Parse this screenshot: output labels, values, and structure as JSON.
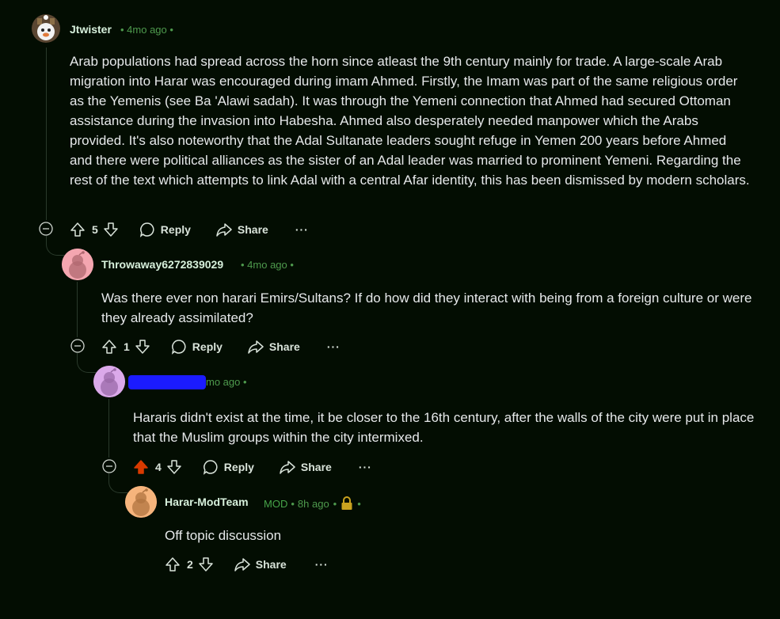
{
  "comments": [
    {
      "username": "Jtwister",
      "time": "4mo ago",
      "body": "Arab populations had spread across the horn since atleast the 9th century mainly for trade. A large-scale Arab migration into Harar was encouraged during imam Ahmed. Firstly, the Imam was part of the same religious order as the Yemenis (see Ba 'Alawi sadah). It was through the Yemeni connection that Ahmed had secured Ottoman assistance during the invasion into Habesha. Ahmed also desperately needed manpower which the Arabs provided. It's also noteworthy that the Adal Sultanate leaders sought refuge in Yemen 200 years before Ahmed and there were political alliances as the sister of an Adal leader was married to prominent Yemeni. Regarding the rest of the text which attempts to link Adal with a central Afar identity, this has been dismissed by modern scholars.",
      "votes": "5",
      "reply_label": "Reply",
      "share_label": "Share",
      "more_label": "···"
    },
    {
      "username": "Throwaway6272839029",
      "time": "4mo ago",
      "body": "Was there ever non harari Emirs/Sultans? If do how did they interact with being from a foreign culture or were they already assimilated?",
      "votes": "1",
      "reply_label": "Reply",
      "share_label": "Share",
      "more_label": "···"
    },
    {
      "username": "",
      "time": "3mo ago",
      "time_visible": "mo ago",
      "body": "Hararis didn't exist at the time, it be closer to the 16th century, after the walls of the city were put in place that the Muslim groups within the city intermixed.",
      "votes": "4",
      "upvoted": true,
      "reply_label": "Reply",
      "share_label": "Share",
      "more_label": "···"
    },
    {
      "username": "Harar-ModTeam",
      "flair": "MOD",
      "time": "8h ago",
      "body": "Off topic discussion",
      "votes": "2",
      "share_label": "Share",
      "more_label": "···"
    }
  ],
  "colors": {
    "background": "#030d02",
    "meta_green": "#4e9a4d",
    "upvote_active": "#d93a00",
    "lock": "#c9a21f",
    "redaction": "#1b1bff"
  },
  "icons": [
    "collapse-icon",
    "upvote-icon",
    "downvote-icon",
    "comment-icon",
    "share-icon",
    "more-icon",
    "lock-icon",
    "avatar-icon"
  ]
}
